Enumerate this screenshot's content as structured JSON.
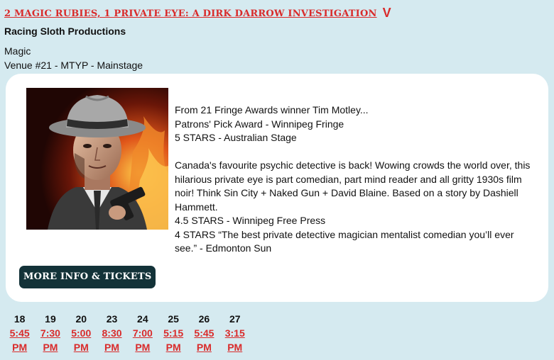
{
  "show": {
    "title": "2 MAGIC RUBIES, 1 PRIVATE EYE: A DIRK DARROW INVESTIGATION",
    "toggle_glyph": "V",
    "company": "Racing Sloth Productions",
    "genre": "Magic",
    "venue": "Venue #21 - MTYP - Mainstage"
  },
  "description": {
    "lines1": [
      "From 21 Fringe Awards winner Tim Motley...",
      "Patrons' Pick Award - Winnipeg Fringe",
      "5 STARS - Australian Stage"
    ],
    "paragraph": "Canada's favourite psychic detective is back! Wowing crowds the world over, this hilarious private eye is part comedian, part mind reader and all gritty 1930s film noir! Think Sin City + Naked Gun + David Blaine. Based on a story by Dashiell Hammett.",
    "review1": "4.5 STARS - Winnipeg Free Press",
    "review2": "4 STARS “The best private detective magician mentalist comedian you’ll ever see.” - Edmonton Sun"
  },
  "button": {
    "label": "MORE INFO & TICKETS"
  },
  "image": {
    "icon": "detective-photo"
  },
  "showtimes": [
    {
      "day": "18",
      "time": "5:45",
      "ampm": "PM"
    },
    {
      "day": "19",
      "time": "7:30",
      "ampm": "PM"
    },
    {
      "day": "20",
      "time": "5:00",
      "ampm": "PM"
    },
    {
      "day": "23",
      "time": "8:30",
      "ampm": "PM"
    },
    {
      "day": "24",
      "time": "7:00",
      "ampm": "PM"
    },
    {
      "day": "25",
      "time": "5:15",
      "ampm": "PM"
    },
    {
      "day": "26",
      "time": "5:45",
      "ampm": "PM"
    },
    {
      "day": "27",
      "time": "3:15",
      "ampm": "PM"
    }
  ],
  "colors": {
    "accent": "#d92b2b",
    "button": "#133238",
    "background": "#d5eaf0"
  }
}
